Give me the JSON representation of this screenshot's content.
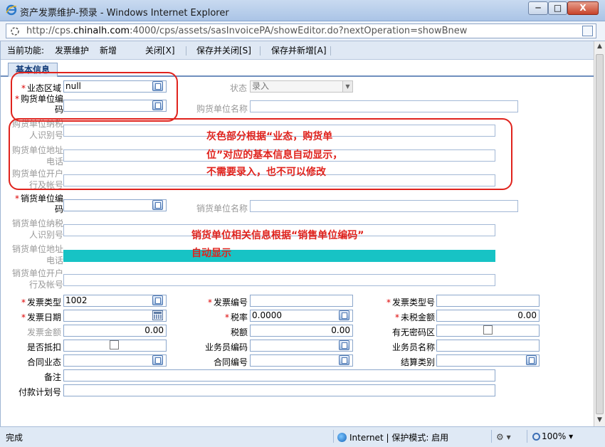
{
  "window": {
    "title": "资产发票维护-预录 - Windows Internet Explorer",
    "url_prefix": "http://cps.",
    "url_host": "chinalh.com",
    "url_suffix": ":4000/cps/assets/sasInvoicePA/showEditor.do?nextOperation=showBnew",
    "min_label": "─",
    "max_label": "□",
    "close_label": "X"
  },
  "toolbar": {
    "current_function_label": "当前功能:",
    "module": "发票维护",
    "mode": "新增",
    "close_button": "关闭[X]",
    "save_close_button": "保存并关闭[S]",
    "save_new_button": "保存并新增[A]"
  },
  "tab": {
    "label": "基本信息"
  },
  "form": {
    "business_area": {
      "label": "业态区域",
      "value": "null"
    },
    "status": {
      "label": "状态",
      "value": "录入"
    },
    "buyer_code": {
      "label_line1": "购货单位编",
      "label_line2": "码",
      "value": ""
    },
    "buyer_name": {
      "label": "购货单位名称",
      "value": ""
    },
    "buyer_tax_id": {
      "label_line1": "购货单位纳税",
      "label_line2": "人识别号",
      "value": ""
    },
    "buyer_address": {
      "label_line1": "购货单位地址",
      "label_line2": "电话",
      "value": ""
    },
    "buyer_bank": {
      "label_line1": "购货单位开户",
      "label_line2": "行及帐号",
      "value": ""
    },
    "seller_code": {
      "label_line1": "销货单位编",
      "label_line2": "码",
      "value": ""
    },
    "seller_name": {
      "label": "销货单位名称",
      "value": ""
    },
    "seller_tax_id": {
      "label_line1": "销货单位纳税",
      "label_line2": "人识别号",
      "value": ""
    },
    "seller_address": {
      "label_line1": "销货单位地址",
      "label_line2": "电话",
      "value": ""
    },
    "seller_bank": {
      "label_line1": "销货单位开户",
      "label_line2": "行及帐号",
      "value": ""
    },
    "invoice_type": {
      "label": "发票类型",
      "value": "1002"
    },
    "invoice_number": {
      "label": "发票编号",
      "value": ""
    },
    "invoice_type_code": {
      "label": "发票类型号",
      "value": ""
    },
    "invoice_date": {
      "label": "发票日期",
      "value": ""
    },
    "tax_rate": {
      "label": "税率",
      "value": "0.0000"
    },
    "pre_tax_amount": {
      "label": "未税金额",
      "value": "0.00"
    },
    "invoice_amount": {
      "label": "发票金额",
      "value": "0.00"
    },
    "tax_amount": {
      "label": "税额",
      "value": "0.00"
    },
    "has_cipher_area": {
      "label": "有无密码区"
    },
    "is_deduct": {
      "label": "是否抵扣"
    },
    "salesman_code": {
      "label": "业务员编码",
      "value": ""
    },
    "salesman_name": {
      "label": "业务员名称",
      "value": ""
    },
    "contract_business": {
      "label": "合同业态",
      "value": ""
    },
    "contract_number": {
      "label": "合同编号",
      "value": ""
    },
    "settlement_type": {
      "label": "结算类别",
      "value": ""
    },
    "remarks": {
      "label": "备注",
      "value": ""
    },
    "payment_plan_no": {
      "label": "付款计划号",
      "value": ""
    }
  },
  "annotations": {
    "buyer_note_line1": "灰色部分根据“业态，购货单",
    "buyer_note_line2": "位”对应的基本信息自动显示，",
    "buyer_note_line3": "不需要录入，也不可以修改",
    "seller_note_line1": "销货单位相关信息根据“销售单位编码”",
    "seller_note_line2": "自动显示",
    "annotation_color": "#e0231d",
    "highlight_color": "#17c3c5"
  },
  "statusbar": {
    "done": "完成",
    "zone": "Internet | 保护模式: 启用",
    "zoom": "100%"
  }
}
